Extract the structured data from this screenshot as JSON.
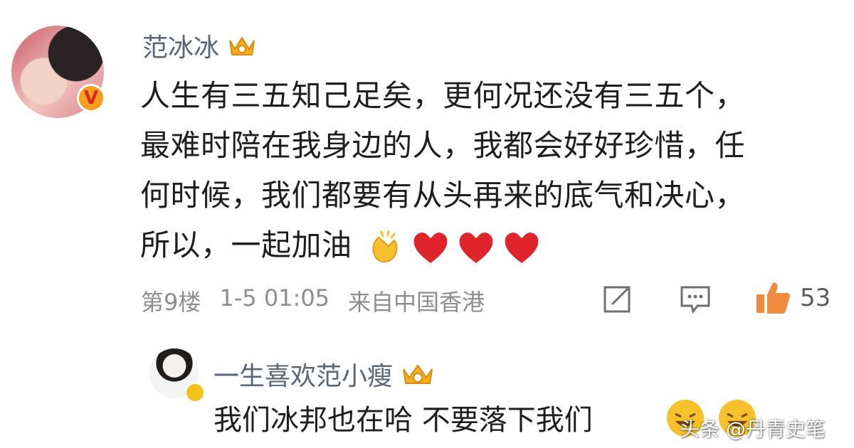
{
  "comment": {
    "username": "范冰冰",
    "text_lines": [
      "人生有三五知己足矣，更何况还没有三五个，",
      "最难时陪在我身边的人，我都会好好珍惜，任",
      "何时候，我们都要有从头再来的底气和决心，",
      "所以，一起加油"
    ],
    "emojis": [
      "clapping-hands-icon",
      "red-heart-icon",
      "red-heart-icon",
      "red-heart-icon"
    ],
    "floor": "第9楼",
    "time": "1-5 01:05",
    "location": "来自中国香港",
    "like_count": "53",
    "badge_icon": "verified-v-icon"
  },
  "reply": {
    "username": "一生喜欢范小瘦",
    "text": "我们冰邦也在哈 不要落下我们",
    "emojis": [
      "laughing-face-icon",
      "laughing-face-icon"
    ]
  },
  "watermark": "头条 @丹青史笔",
  "colors": {
    "username": "#5a6577",
    "text": "#1e1e1e",
    "meta": "#8d8d8d",
    "heart": "#e0242c",
    "like_thumb": "#f08a3c",
    "crown": "#f2b01e"
  }
}
